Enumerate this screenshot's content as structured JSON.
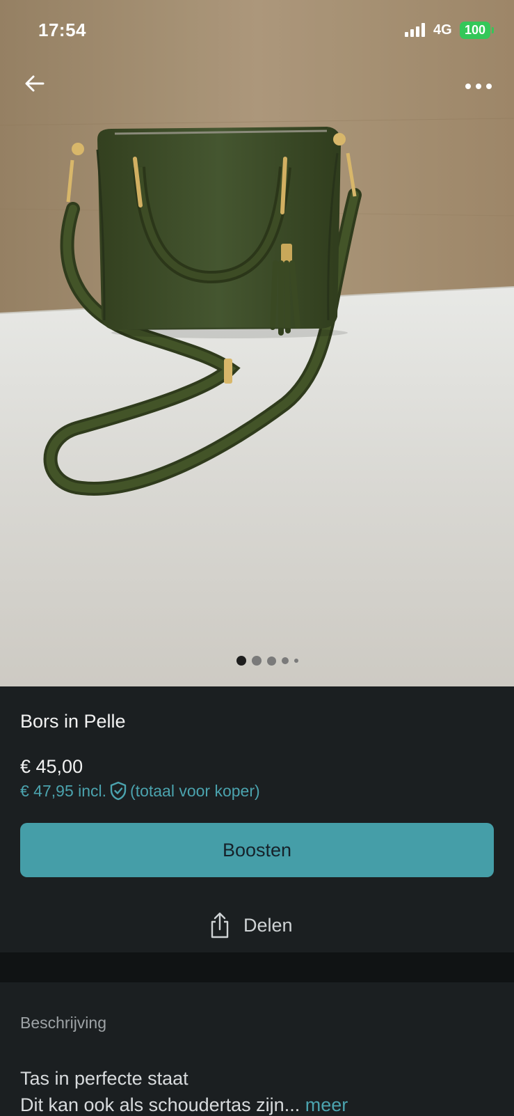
{
  "status_bar": {
    "time": "17:54",
    "network": "4G",
    "battery": "100"
  },
  "gallery": {
    "dot_count": 5,
    "active_index": 0
  },
  "item": {
    "title": "Bors in Pelle",
    "price": "€ 45,00",
    "price_incl": "€ 47,95 incl.",
    "price_incl_note": "(totaal voor koper)"
  },
  "actions": {
    "boost_label": "Boosten",
    "share_label": "Delen"
  },
  "description": {
    "heading": "Beschrijving",
    "line1": "Tas in perfecte staat",
    "line2": "Dit kan ook als schoudertas zijn...",
    "more_label": "meer"
  },
  "colors": {
    "accent": "#459ea8",
    "link": "#4ba3ae",
    "background": "#1b1f21",
    "battery": "#34c759"
  }
}
